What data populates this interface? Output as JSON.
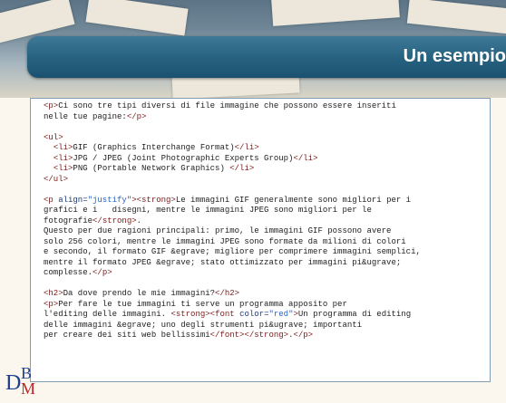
{
  "slide": {
    "title": "Un esempio",
    "accent_color": "#25617f",
    "logo": {
      "d": "D",
      "b": "B",
      "m": "M"
    }
  },
  "code_lines": [
    [
      {
        "c": "tag",
        "t": "<p>"
      },
      {
        "c": "txt",
        "t": "Ci sono tre tipi diversi di file immagine che possono essere inseriti"
      }
    ],
    [
      {
        "c": "txt",
        "t": "nelle tue pagine:"
      },
      {
        "c": "tag",
        "t": "</p>"
      }
    ],
    [],
    [
      {
        "c": "tag",
        "t": "<ul>"
      }
    ],
    [
      {
        "c": "txt",
        "t": "  "
      },
      {
        "c": "tag",
        "t": "<li>"
      },
      {
        "c": "txt",
        "t": "GIF (Graphics Interchange Format)"
      },
      {
        "c": "tag",
        "t": "</li>"
      }
    ],
    [
      {
        "c": "txt",
        "t": "  "
      },
      {
        "c": "tag",
        "t": "<li>"
      },
      {
        "c": "txt",
        "t": "JPG / JPEG (Joint Photographic Experts Group)"
      },
      {
        "c": "tag",
        "t": "</li>"
      }
    ],
    [
      {
        "c": "txt",
        "t": "  "
      },
      {
        "c": "tag",
        "t": "<li>"
      },
      {
        "c": "txt",
        "t": "PNG (Portable Network Graphics) "
      },
      {
        "c": "tag",
        "t": "</li>"
      }
    ],
    [
      {
        "c": "tag",
        "t": "</ul>"
      }
    ],
    [],
    [
      {
        "c": "tag",
        "t": "<p "
      },
      {
        "c": "attr",
        "t": "align="
      },
      {
        "c": "val",
        "t": "\"justify\""
      },
      {
        "c": "tag",
        "t": "><strong>"
      },
      {
        "c": "txt",
        "t": "Le immagini GIF generalmente sono migliori per i"
      }
    ],
    [
      {
        "c": "txt",
        "t": "grafici e i   disegni, mentre le immagini JPEG sono migliori per le"
      }
    ],
    [
      {
        "c": "txt",
        "t": "fotografie"
      },
      {
        "c": "tag",
        "t": "</strong>"
      },
      {
        "c": "txt",
        "t": "."
      }
    ],
    [
      {
        "c": "txt",
        "t": "Questo per due ragioni principali: primo, le immagini GIF possono avere"
      }
    ],
    [
      {
        "c": "txt",
        "t": "solo 256 colori, mentre le immagini JPEG sono formate da milioni di colori"
      }
    ],
    [
      {
        "c": "txt",
        "t": "e secondo, il formato GIF &egrave; migliore per comprimere immagini semplici,"
      }
    ],
    [
      {
        "c": "txt",
        "t": "mentre il formato JPEG &egrave; stato ottimizzato per immagini pi&ugrave;"
      }
    ],
    [
      {
        "c": "txt",
        "t": "complesse."
      },
      {
        "c": "tag",
        "t": "</p>"
      }
    ],
    [],
    [
      {
        "c": "tag",
        "t": "<h2>"
      },
      {
        "c": "txt",
        "t": "Da dove prendo le mie immagini?"
      },
      {
        "c": "tag",
        "t": "</h2>"
      }
    ],
    [
      {
        "c": "tag",
        "t": "<p>"
      },
      {
        "c": "txt",
        "t": "Per fare le tue immagini ti serve un programma apposito per"
      }
    ],
    [
      {
        "c": "txt",
        "t": "l'editing delle immagini. "
      },
      {
        "c": "tag",
        "t": "<strong><font "
      },
      {
        "c": "attr",
        "t": "color="
      },
      {
        "c": "val",
        "t": "\"red\""
      },
      {
        "c": "tag",
        "t": ">"
      },
      {
        "c": "txt",
        "t": "Un programma di editing"
      }
    ],
    [
      {
        "c": "txt",
        "t": "delle immagini &egrave; uno degli strumenti pi&ugrave; importanti"
      }
    ],
    [
      {
        "c": "txt",
        "t": "per creare dei siti web bellissimi"
      },
      {
        "c": "tag",
        "t": "</font></strong>"
      },
      {
        "c": "txt",
        "t": "."
      },
      {
        "c": "tag",
        "t": "</p>"
      }
    ]
  ]
}
